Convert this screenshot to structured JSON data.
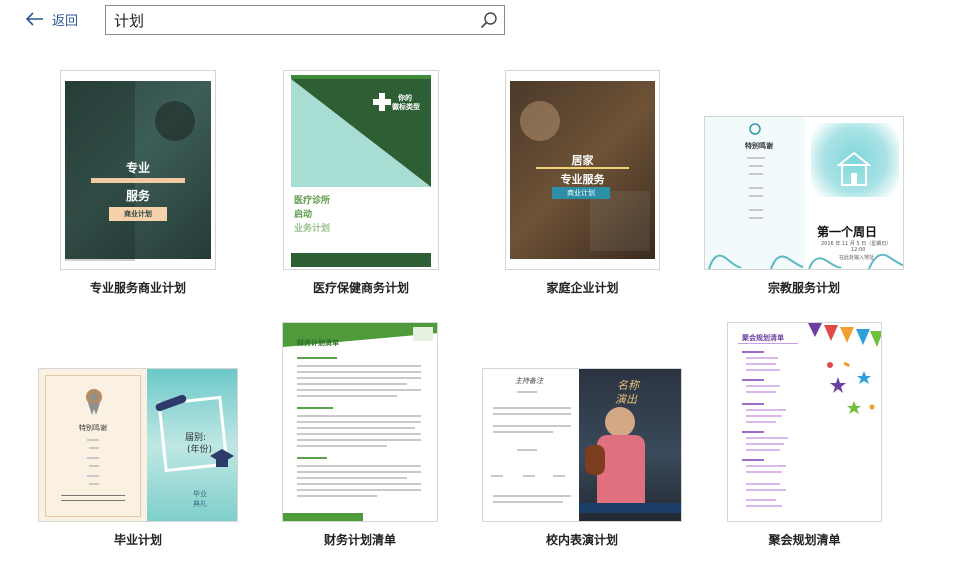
{
  "header": {
    "back_label": "返回",
    "search_value": "计划"
  },
  "templates": [
    {
      "label": "专业服务商业计划",
      "text_line1": "专业",
      "text_line2": "服务",
      "chip": "商业计划"
    },
    {
      "label": "医疗保健商务计划",
      "badge_line1": "你的",
      "badge_line2": "徽标类型",
      "line1": "医疗诊所",
      "line2": "启动",
      "line3": "业务计划"
    },
    {
      "label": "家庭企业计划",
      "text_line1": "居家",
      "text_line2": "专业服务",
      "chip": "商业计划"
    },
    {
      "label": "宗教服务计划",
      "left_title": "特别鸣谢",
      "right_title": "第一个周日",
      "date_line": "2016 年 11 月 5 日（星期日）",
      "time_line": "12:00",
      "place_line": "在此处输入地址"
    },
    {
      "label": "毕业计划",
      "left_title": "特别鸣谢",
      "right_line1": "届别:",
      "right_line2": "(年份)",
      "footer1": "毕业",
      "footer2": "典礼"
    },
    {
      "label": "财务计划清单",
      "title": "财务计划清单"
    },
    {
      "label": "校内表演计划",
      "left_title": "主持备注",
      "right_title1": "名称",
      "right_title2": "演出"
    },
    {
      "label": "聚会规划清单",
      "title": "聚会规划清单"
    }
  ],
  "colors": {
    "accent": "#2b5797",
    "card_border": "#d6d6d6",
    "green": "#3e8a3a",
    "teal": "#62c3c8"
  }
}
